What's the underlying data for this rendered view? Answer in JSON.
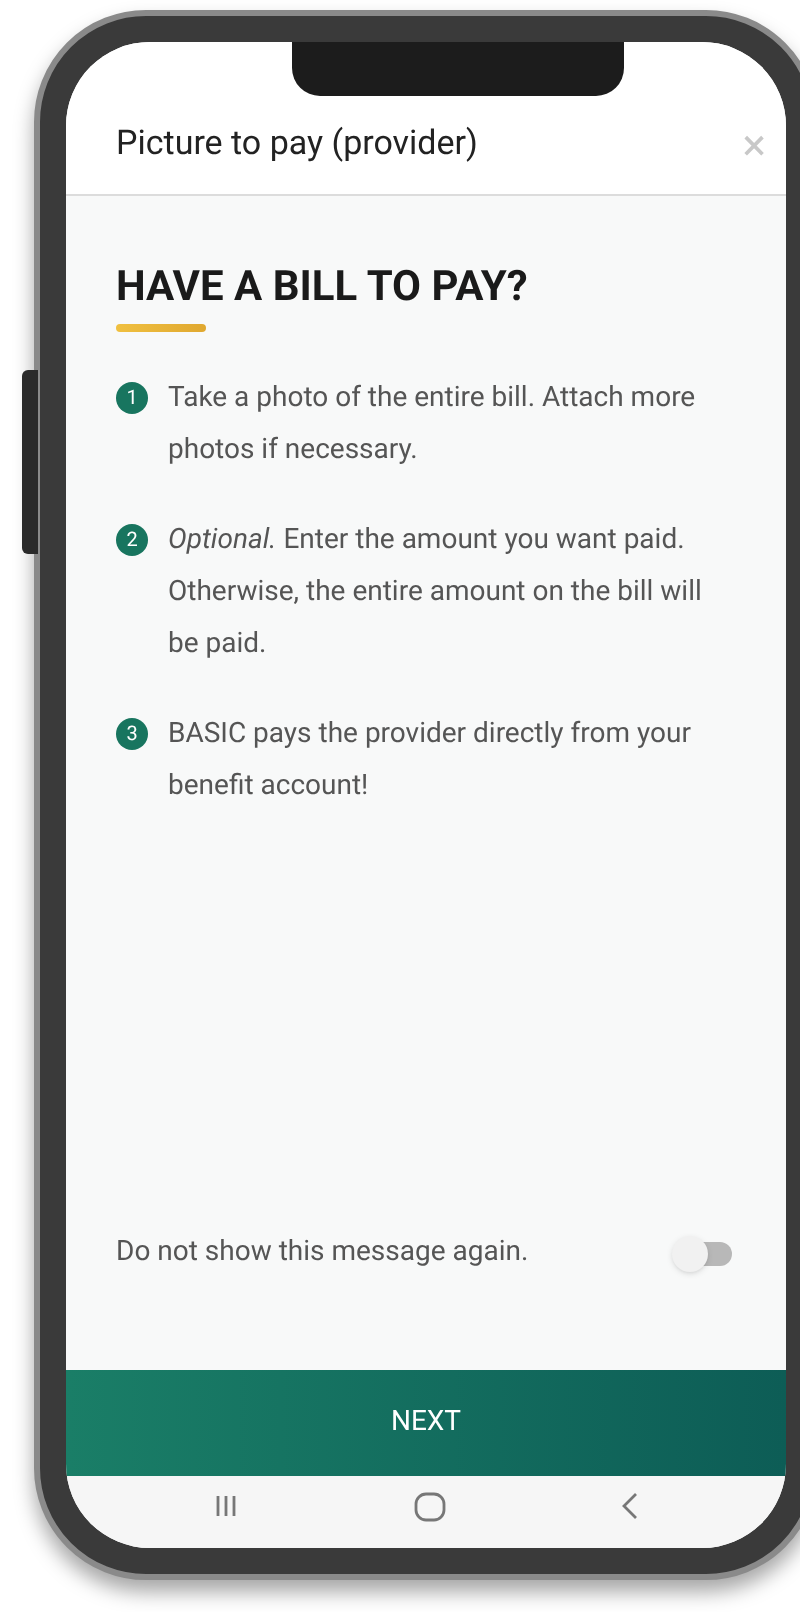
{
  "header": {
    "title": "Picture to pay (provider)",
    "close": "×"
  },
  "heading": "HAVE A BILL TO PAY?",
  "steps": [
    {
      "number": "1",
      "text": "Take a photo of the entire bill. Attach more photos if necessary."
    },
    {
      "number": "2",
      "text": "*Optional.* Enter the amount you want paid. Otherwise, the entire amount on the bill will be paid."
    },
    {
      "number": "3",
      "text": "BASIC pays the provider directly from your benefit account!"
    }
  ],
  "dont_show_again": {
    "label": "Do not show this message again.",
    "on": false
  },
  "next_button": "NEXT"
}
